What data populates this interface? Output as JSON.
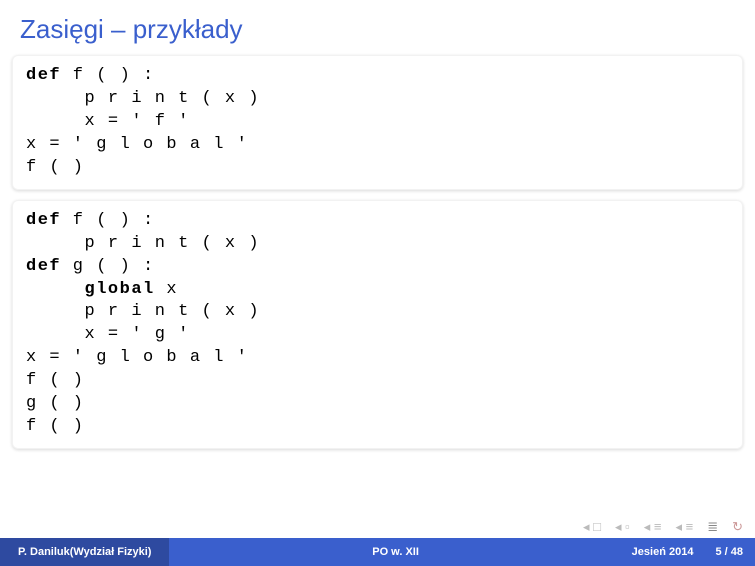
{
  "title": "Zasięgi – przykłady",
  "code1": {
    "l1a": "def",
    "l1b": " f ( ) :",
    "l2": "     p r i n t ( x )",
    "l3": "     x = ' f '",
    "l4": "",
    "l5": "x = ' g l o b a l '",
    "l6": "f ( )"
  },
  "code2": {
    "l1a": "def",
    "l1b": " f ( ) :",
    "l2": "     p r i n t ( x )",
    "l3": "",
    "l4a": "def",
    "l4b": " g ( ) :",
    "l5a": "     global",
    "l5b": " x",
    "l6": "     p r i n t ( x )",
    "l7": "     x = ' g '",
    "l8": "",
    "l9": "x = ' g l o b a l '",
    "l10": "f ( )",
    "l11": "g ( )",
    "l12": "f ( )"
  },
  "footer": {
    "author": "P. Daniluk(Wydział Fizyki)",
    "course": "PO w. XII",
    "term": "Jesień 2014",
    "page_current": "5",
    "page_sep": " / ",
    "page_total": "48"
  }
}
